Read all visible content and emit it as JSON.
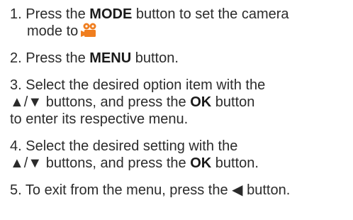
{
  "steps": [
    {
      "number": "1.",
      "pre": "Press the",
      "key": "MODE",
      "post": "button to set the camera",
      "line2": "mode to",
      "icon": "video-camera-icon",
      "icon_color": "#f07e1f"
    },
    {
      "number": "2.",
      "pre": "Press the",
      "key": "MENU",
      "post": "button."
    },
    {
      "number": "3.",
      "line1": "Select the desired option item with the",
      "arrows": "▲/▼",
      "mid": "buttons, and press the",
      "key": "OK",
      "post": "button",
      "line3": "to enter its respective menu."
    },
    {
      "number": "4.",
      "line1": "Select the desired setting with the",
      "arrows": "▲/▼",
      "mid": "buttons, and press the",
      "key": "OK",
      "post": "button."
    },
    {
      "number": "5.",
      "text": "To exit from the menu, press the",
      "arrow": "◀",
      "post": "button."
    }
  ]
}
